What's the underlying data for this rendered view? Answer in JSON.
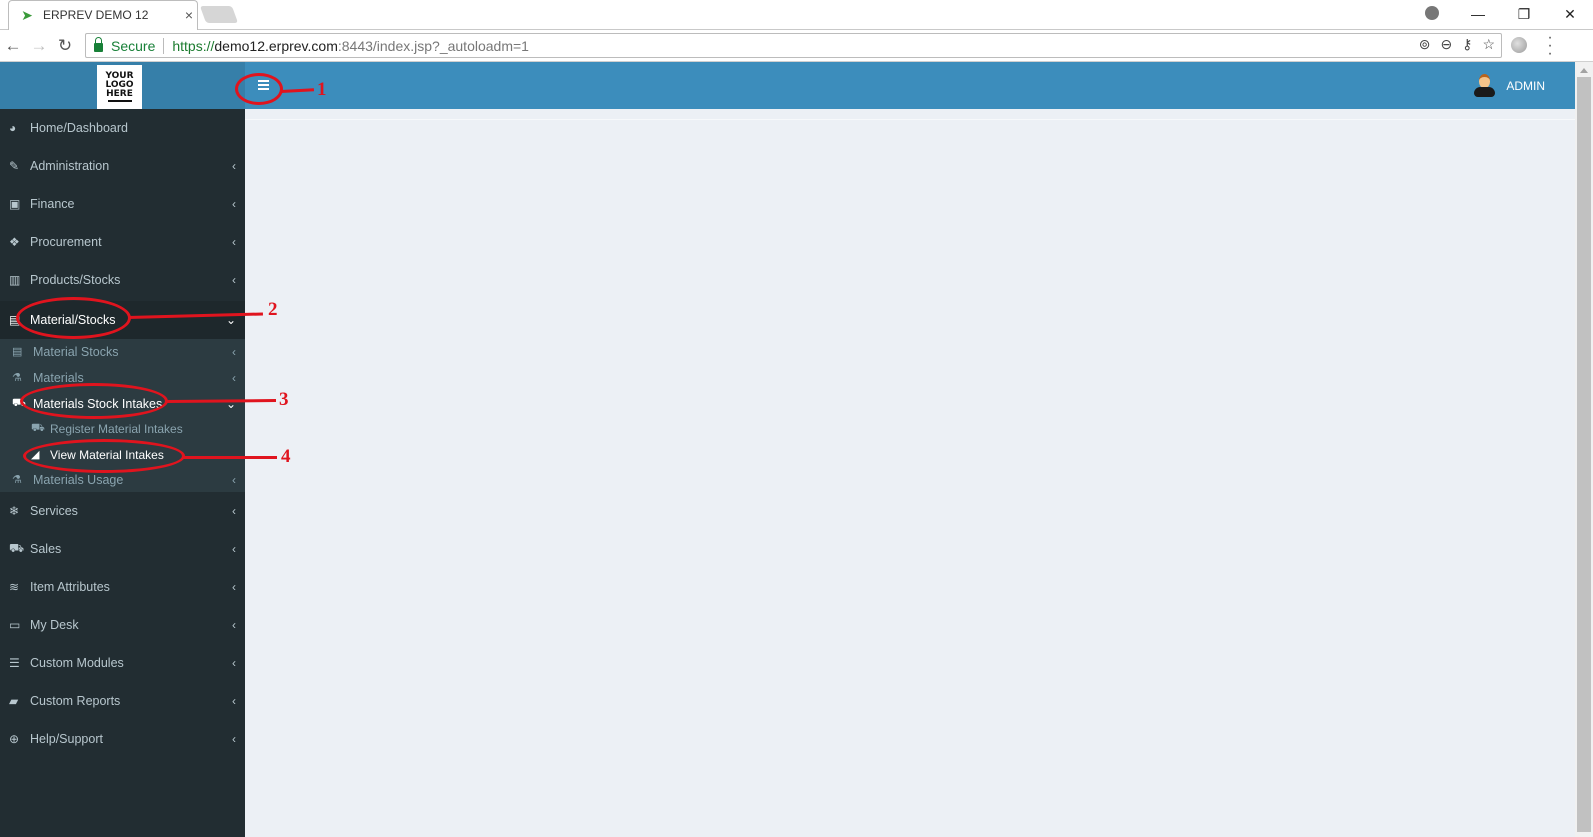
{
  "browser": {
    "tab_title": "ERPREV DEMO 12",
    "tab_favicon": "erprev-bird-icon",
    "tab_close": "×",
    "window_controls": {
      "minimize": "—",
      "restore": "❐",
      "close": "✕"
    },
    "nav": {
      "back": "←",
      "forward": "→",
      "reload": "↻"
    },
    "secure_label": "Secure",
    "url": {
      "scheme": "https://",
      "host": "demo12.erprev.com",
      "rest": ":8443/index.jsp?_autoloadm=1"
    },
    "omnibox_icons": [
      "location-icon",
      "zoom-out-icon",
      "key-icon",
      "star-icon"
    ],
    "omnibox_glyphs": [
      "⊚",
      "⊖",
      "⚷",
      "☆"
    ],
    "menu_glyph": "⋮"
  },
  "header": {
    "logo_lines": [
      "YOUR",
      "LOGO",
      "HERE"
    ],
    "user_name": "ADMIN"
  },
  "sidebar": {
    "items": [
      {
        "label": "Home/Dashboard",
        "icon": "dashboard-icon",
        "glyph": "◕",
        "chevron": ""
      },
      {
        "label": "Administration",
        "icon": "ticket-icon",
        "glyph": "✎",
        "chevron": "‹"
      },
      {
        "label": "Finance",
        "icon": "money-icon",
        "glyph": "▣",
        "chevron": "‹"
      },
      {
        "label": "Procurement",
        "icon": "cubes-icon",
        "glyph": "❖",
        "chevron": "‹"
      },
      {
        "label": "Products/Stocks",
        "icon": "building-icon",
        "glyph": "▥",
        "chevron": "‹"
      },
      {
        "label": "Material/Stocks",
        "icon": "trash-bin-icon",
        "glyph": "▤",
        "chevron": "⌄",
        "active": true
      },
      {
        "label": "Services",
        "icon": "snowflake-icon",
        "glyph": "❄",
        "chevron": "‹"
      },
      {
        "label": "Sales",
        "icon": "cart-icon",
        "glyph": "⛟",
        "chevron": "‹"
      },
      {
        "label": "Item Attributes",
        "icon": "spotify-icon",
        "glyph": "≋",
        "chevron": "‹"
      },
      {
        "label": "My Desk",
        "icon": "desktop-icon",
        "glyph": "▭",
        "chevron": "‹"
      },
      {
        "label": "Custom Modules",
        "icon": "database-icon",
        "glyph": "☰",
        "chevron": "‹"
      },
      {
        "label": "Custom Reports",
        "icon": "book-icon",
        "glyph": "▰",
        "chevron": "‹"
      },
      {
        "label": "Help/Support",
        "icon": "life-ring-icon",
        "glyph": "⊕",
        "chevron": "‹"
      }
    ],
    "material_submenu": [
      {
        "label": "Material Stocks",
        "icon": "trash-bin-icon",
        "glyph": "▤",
        "chevron": "‹"
      },
      {
        "label": "Materials",
        "icon": "flask-icon",
        "glyph": "⚗",
        "chevron": "‹"
      },
      {
        "label": "Materials Stock Intakes",
        "icon": "truck-icon",
        "glyph": "⛟",
        "chevron": "⌄",
        "open": true
      },
      {
        "label": "Materials Usage",
        "icon": "flask-icon",
        "glyph": "⚗",
        "chevron": "‹"
      }
    ],
    "intake_submenu": [
      {
        "label": "Register Material Intakes",
        "icon": "truck-icon",
        "glyph": "⛟"
      },
      {
        "label": "View Material Intakes",
        "icon": "area-chart-icon",
        "glyph": "◢",
        "active": true
      }
    ]
  },
  "annotations": {
    "labels": [
      "1",
      "2",
      "3",
      "4"
    ],
    "color": "#e0141e"
  },
  "colors": {
    "header_blue": "#3c8dbc",
    "logo_area_blue": "#367fa9",
    "sidebar_bg": "#222d32",
    "submenu_bg": "#2c3b41",
    "content_bg": "#ecf0f5"
  }
}
